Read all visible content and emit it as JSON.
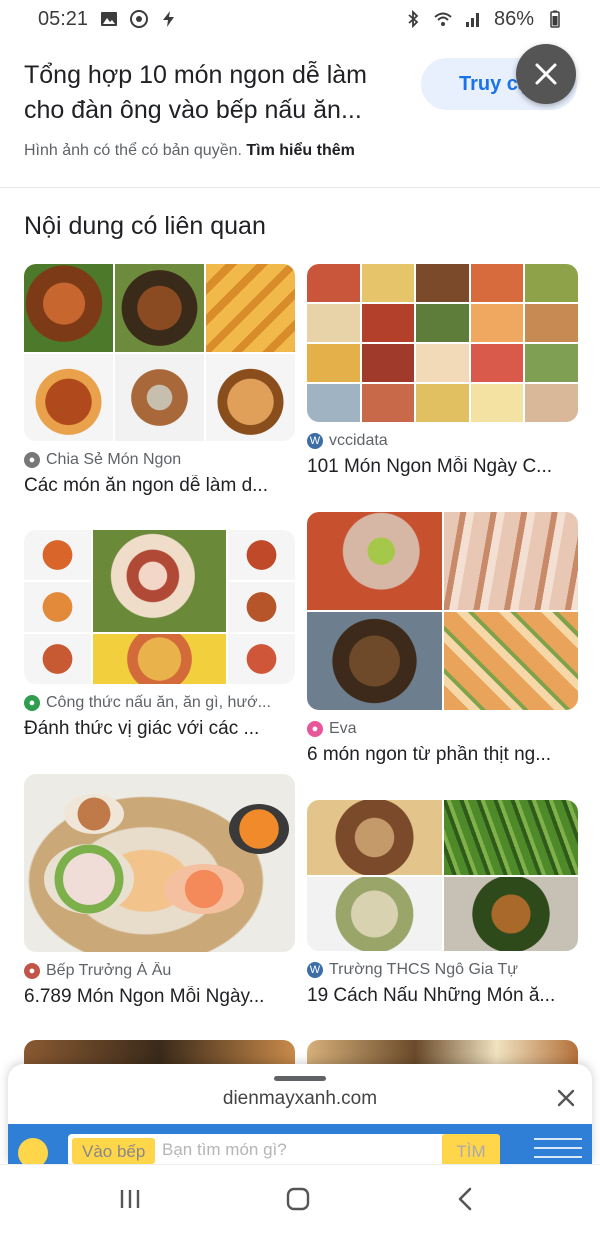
{
  "status_bar": {
    "time": "05:21",
    "battery": "86%",
    "left_icons": [
      "image-icon",
      "chrome-icon",
      "flash-icon"
    ],
    "right_icons": [
      "bluetooth-icon",
      "wifi-icon",
      "signal-icon",
      "battery-icon"
    ]
  },
  "header": {
    "title": "Tổng hợp 10 món ngon dễ làm cho đàn ông vào bếp nấu ăn...",
    "visit_label": "Truy cập",
    "copyright_text": "Hình ảnh có thể có bản quyền.",
    "learn_more": "Tìm hiểu thêm"
  },
  "related": {
    "title": "Nội dung có liên quan",
    "items": [
      {
        "source": "Chia Sẻ Món Ngon",
        "caption": "Các món ăn ngon dễ làm d...",
        "source_icon": "globe-icon"
      },
      {
        "source": "vccidata",
        "caption": "101 Món Ngon Mỗi Ngày C...",
        "source_icon": "wordpress-icon"
      },
      {
        "source": "Công thức nấu ăn, ăn gì, hướ...",
        "caption": "Đánh thức vị giác với các ...",
        "source_icon": "recipe-site-icon"
      },
      {
        "source": "Eva",
        "caption": "6 món ngon từ phần thịt ng...",
        "source_icon": "eva-icon"
      },
      {
        "source": "Bếp Trưởng Á Âu",
        "caption": "6.789 Món Ngon Mỗi Ngày...",
        "source_icon": "chef-icon"
      },
      {
        "source": "Trường THCS Ngô Gia Tự",
        "caption": "19 Cách Nấu Những Món ă...",
        "source_icon": "wordpress-icon"
      }
    ]
  },
  "bottom_sheet": {
    "domain": "dienmayxanh.com",
    "site_tag": "Vào bếp",
    "site_placeholder": "Bạn tìm món gì?",
    "site_search_button": "TÌM"
  },
  "colors": {
    "accent": "#1a73e8",
    "accent_bg": "#e8f0fe",
    "site_blue": "#2f7fd6",
    "site_yellow": "#ffd54a"
  }
}
